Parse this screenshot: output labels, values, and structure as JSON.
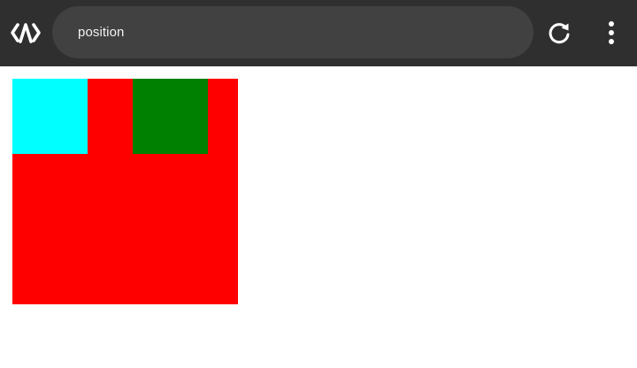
{
  "toolbar": {
    "logo_icon": "code-brackets-logo-icon",
    "url_text": "position",
    "reload_icon": "reload-icon",
    "menu_icon": "kebab-menu-icon",
    "background": "#2f2f2f",
    "pill_background": "#414141"
  },
  "page": {
    "boxes": [
      {
        "name": "red-box",
        "color": "#ff0000"
      },
      {
        "name": "cyan-box",
        "color": "#00ffff"
      },
      {
        "name": "green-box",
        "color": "#008000"
      }
    ]
  }
}
